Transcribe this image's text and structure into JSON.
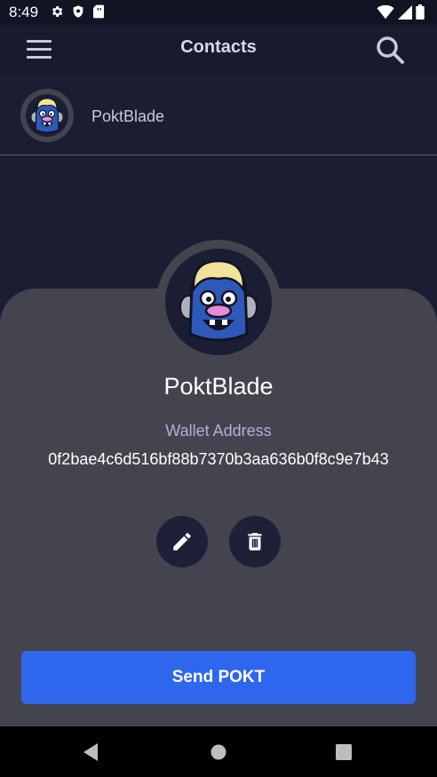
{
  "status_bar": {
    "time": "8:49",
    "left_icons": [
      "gear-icon",
      "shield-icon",
      "sim-card-icon"
    ],
    "right_icons": [
      "wifi-icon",
      "cell-signal-icon",
      "battery-icon"
    ]
  },
  "app_bar": {
    "title": "Contacts",
    "menu_icon": "hamburger-menu-icon",
    "search_icon": "search-icon"
  },
  "contacts": [
    {
      "name": "PoktBlade",
      "avatar": "blue-monster-avatar"
    }
  ],
  "detail": {
    "name": "PoktBlade",
    "wallet_label": "Wallet Address",
    "wallet_address": "0f2bae4c6d516bf88b7370b3aa636b0f8c9e7b43",
    "edit_icon": "pencil-icon",
    "delete_icon": "trash-icon",
    "send_label": "Send POKT"
  },
  "colors": {
    "background": "#1b1d33",
    "sheet": "#44444f",
    "accent": "#2e66ee",
    "round_button": "#1e2038",
    "wallet_label": "#b3b0d6"
  },
  "nav_bar": [
    "back-icon",
    "home-icon",
    "recents-icon"
  ]
}
